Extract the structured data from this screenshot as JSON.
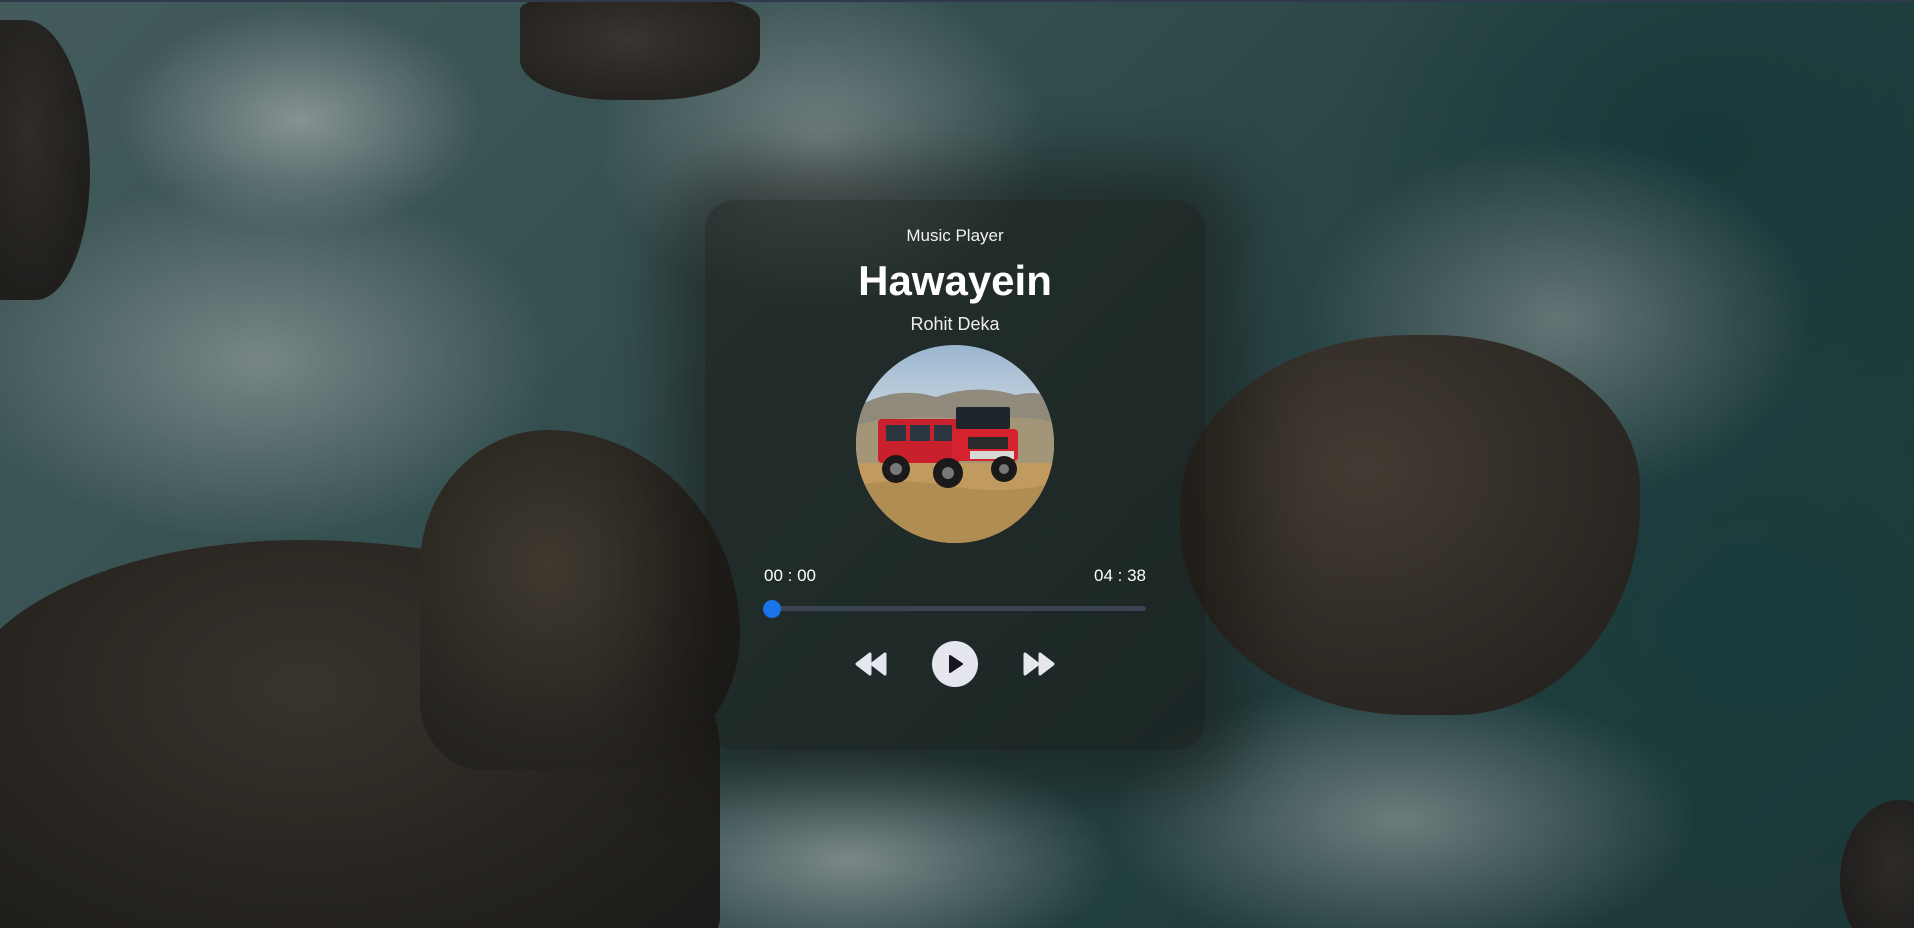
{
  "player": {
    "app_label": "Music Player",
    "song_title": "Hawayein",
    "artist": "Rohit Deka",
    "current_time": "00 : 00",
    "duration": "04 : 38",
    "progress": 0.0
  },
  "icons": {
    "previous": "rewind-icon",
    "play": "play-icon",
    "next": "fast-forward-icon"
  },
  "colors": {
    "accent": "#1a73e8",
    "track": "#3c4352",
    "play_button": "#e6e6ee"
  }
}
